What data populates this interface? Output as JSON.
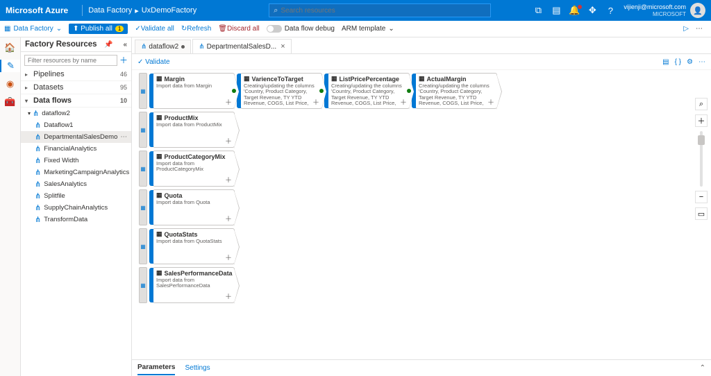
{
  "header": {
    "brand": "Microsoft Azure",
    "breadcrumb1": "Data Factory",
    "breadcrumb2": "UxDemoFactory",
    "search_placeholder": "Search resources",
    "user_email": "vijienji@microsoft.com",
    "user_org": "MICROSOFT"
  },
  "toolbar": {
    "factory_dropdown": "Data Factory",
    "publish_label": "Publish all",
    "publish_count": "1",
    "validate_all": "Validate all",
    "refresh": "Refresh",
    "discard_all": "Discard all",
    "dataflow_debug": "Data flow debug",
    "arm_template": "ARM template"
  },
  "resources": {
    "title": "Factory Resources",
    "filter_placeholder": "Filter resources by name",
    "groups": [
      {
        "name": "Pipelines",
        "count": 46
      },
      {
        "name": "Datasets",
        "count": 95
      },
      {
        "name": "Data flows",
        "count": 10
      }
    ],
    "flows": [
      "dataflow2",
      "Dataflow1",
      "DepartmentalSalesDemo",
      "FinancialAnalytics",
      "Fixed Width",
      "MarketingCampaignAnalytics",
      "SalesAnalytics",
      "Splitfile",
      "SupplyChainAnalytics",
      "TransformData"
    ],
    "selected_flow": "DepartmentalSalesDemo"
  },
  "tabs": {
    "tab1": "dataflow2",
    "tab2": "DepartmentalSalesD..."
  },
  "validate": {
    "label": "Validate"
  },
  "nodes": {
    "row1": [
      {
        "title": "Margin",
        "desc": "Import data from Margin",
        "source": true
      },
      {
        "title": "VarienceToTarget",
        "desc": "Creating/updating the columns 'Country, Product Category, Target Revenue, TY YTD Revenue, COGS, List Price,",
        "source": false
      },
      {
        "title": "ListPricePercentage",
        "desc": "Creating/updating the columns 'Country, Product Category, Target Revenue, TY YTD Revenue, COGS, List Price,",
        "source": false
      },
      {
        "title": "ActualMargin",
        "desc": "Creating/updating the columns 'Country, Product Category, Target Revenue, TY YTD Revenue, COGS, List Price,",
        "source": false
      }
    ],
    "singles": [
      {
        "title": "ProductMix",
        "desc": "Import data from ProductMix"
      },
      {
        "title": "ProductCategoryMix",
        "desc": "Import data from ProductCategoryMix"
      },
      {
        "title": "Quota",
        "desc": "Import data from Quota"
      },
      {
        "title": "QuotaStats",
        "desc": "Import data from QuotaStats"
      },
      {
        "title": "SalesPerformanceData",
        "desc": "Import data from SalesPerformanceData"
      }
    ]
  },
  "bottom_tabs": {
    "parameters": "Parameters",
    "settings": "Settings"
  }
}
